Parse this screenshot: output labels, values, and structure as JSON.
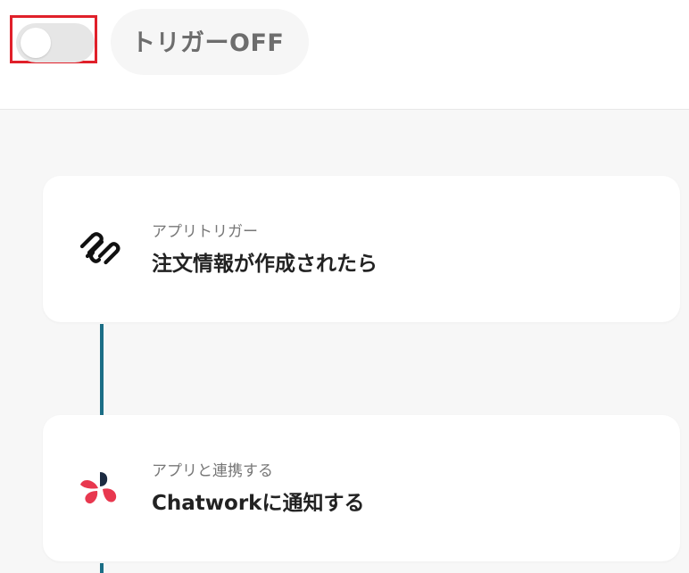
{
  "trigger": {
    "toggle_state": "off",
    "label": "トリガーOFF"
  },
  "flow": {
    "steps": [
      {
        "type_label": "アプリトリガー",
        "title": "注文情報が作成されたら",
        "icon": "squarespace-icon"
      },
      {
        "type_label": "アプリと連携する",
        "title": "Chatworkに通知する",
        "icon": "chatwork-icon"
      }
    ]
  },
  "colors": {
    "highlight": "#e0202a",
    "connector": "#1b6e86",
    "chatwork_red": "#e8384f",
    "chatwork_navy": "#1c2b41"
  }
}
